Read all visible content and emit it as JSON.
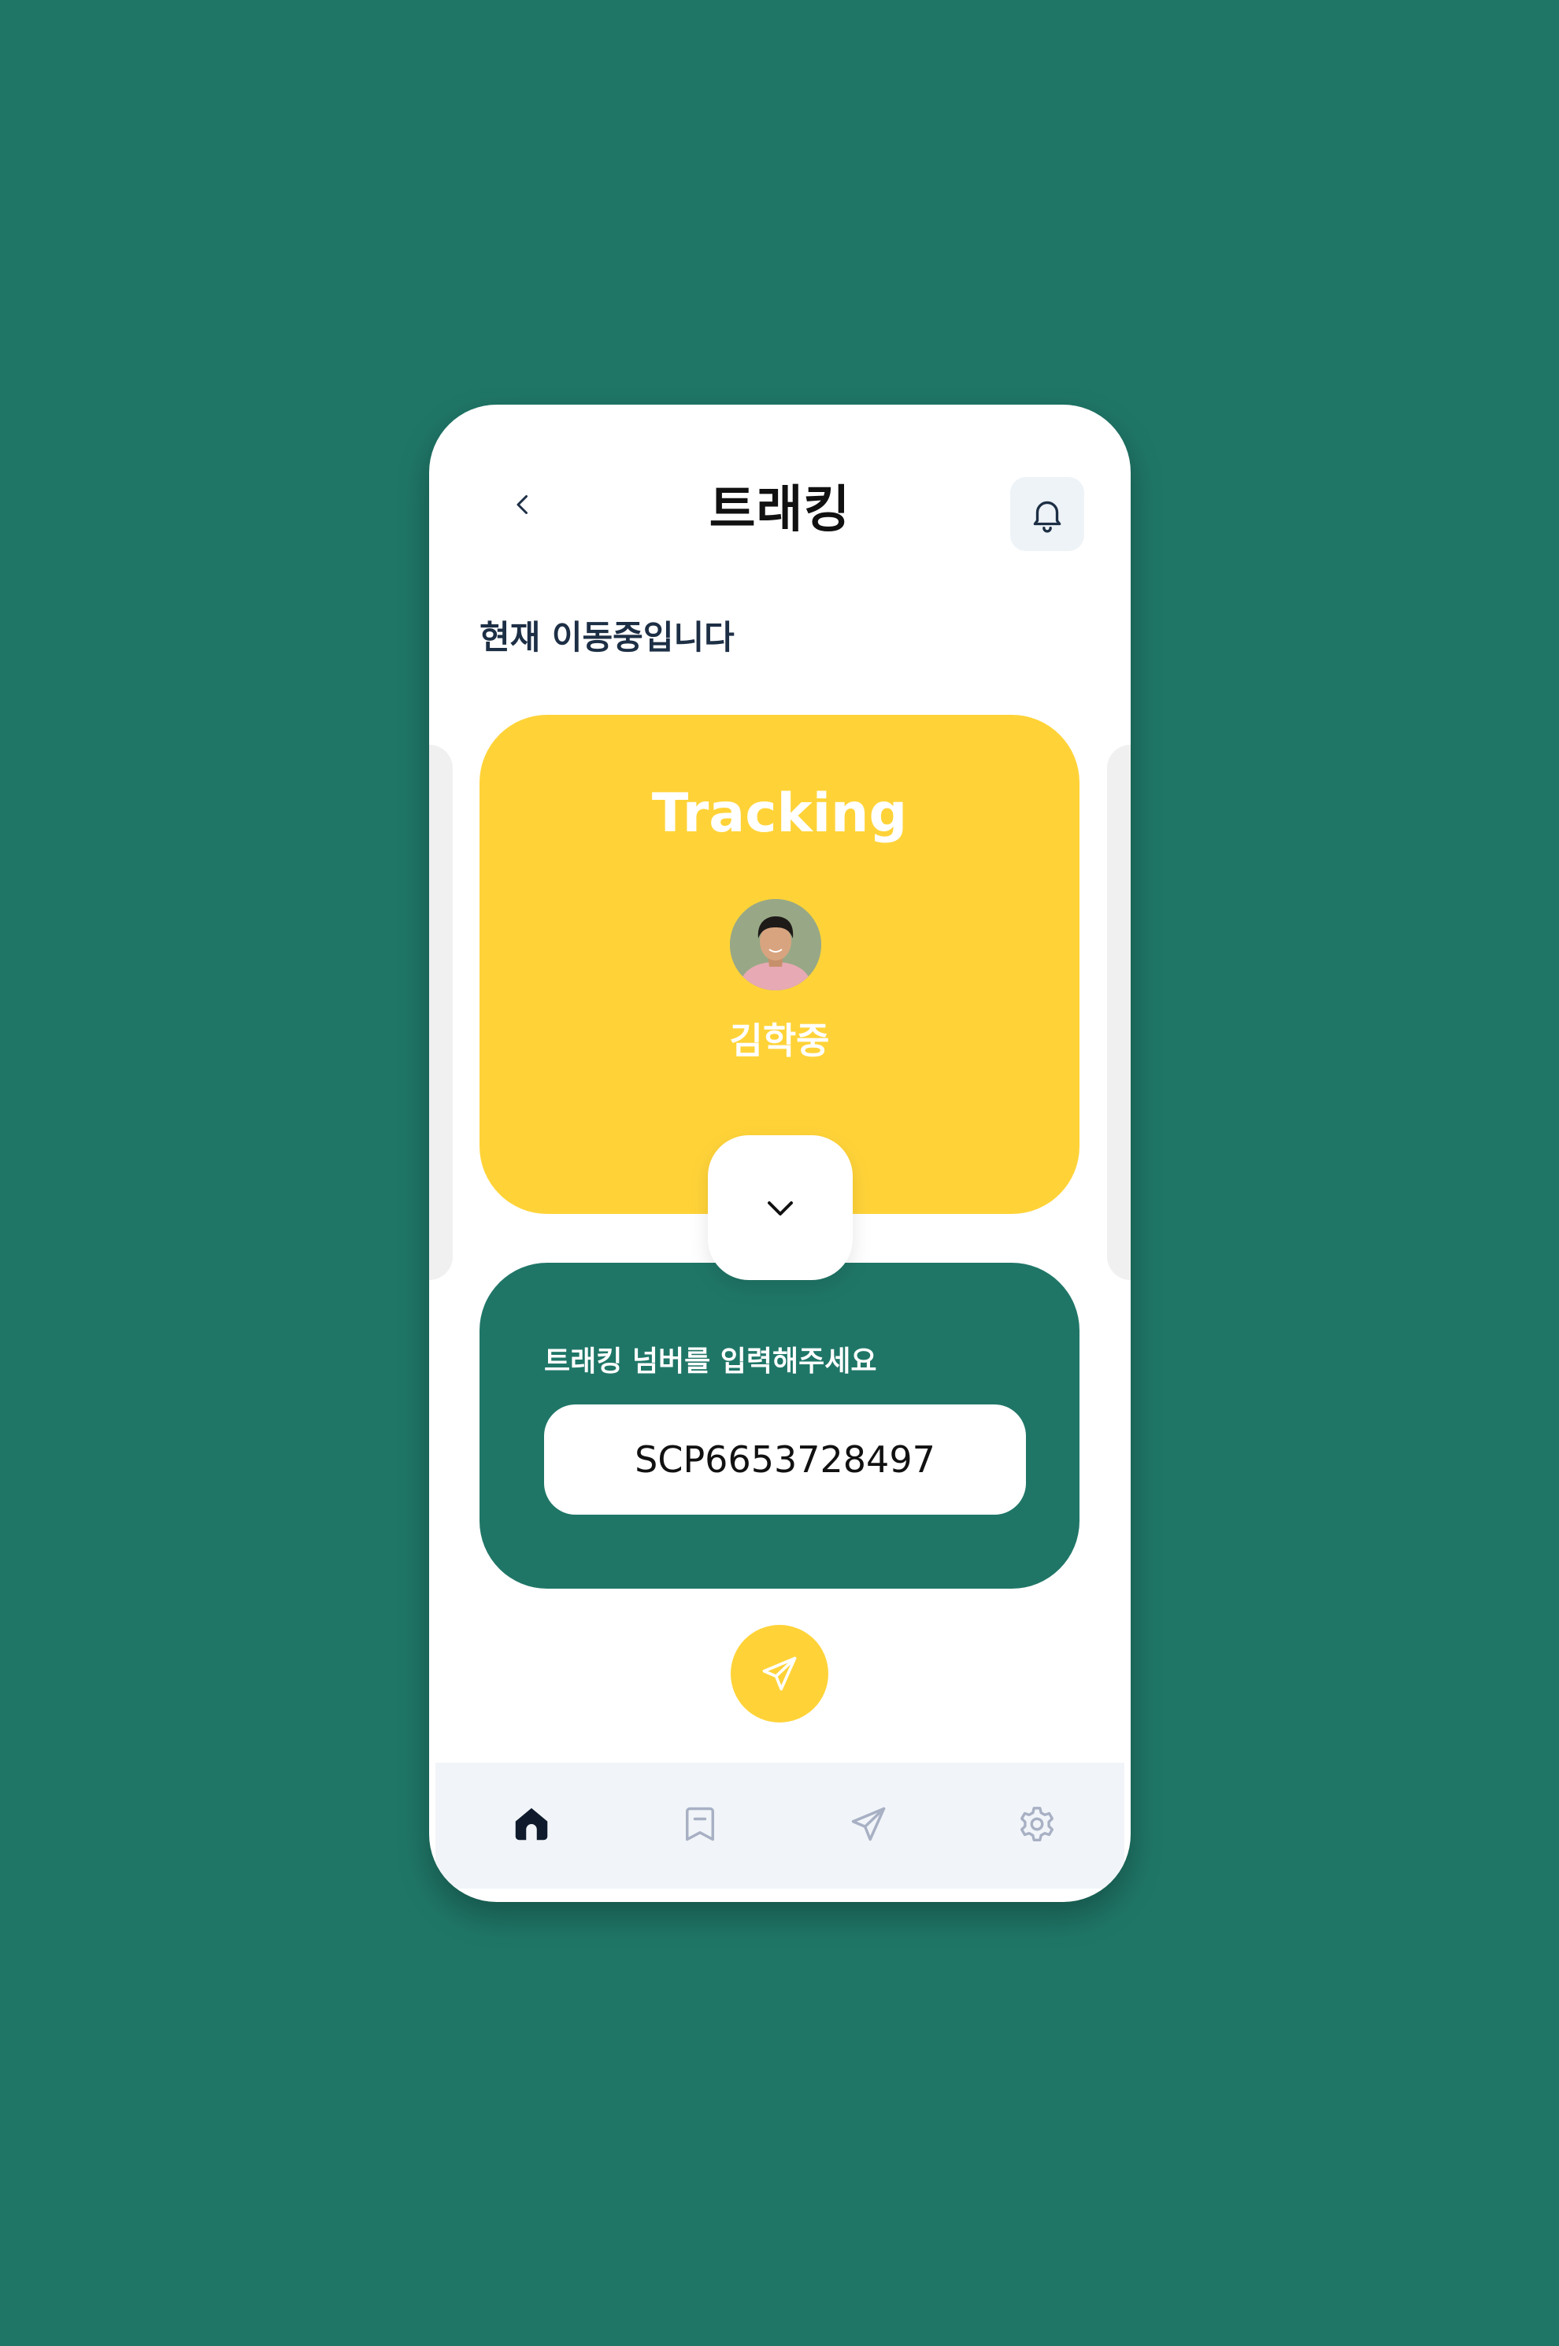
{
  "header": {
    "title": "트래킹",
    "back_icon": "chevron-left-icon",
    "notification_icon": "bell-icon"
  },
  "status": {
    "text": "현재 이동중입니다"
  },
  "tracking_card": {
    "title": "Tracking",
    "name": "김학중",
    "avatar": "avatar-photo",
    "expand_icon": "chevron-down-icon"
  },
  "tracking_input": {
    "label": "트래킹 넘버를 입력해주세요",
    "value": "SCP6653728497"
  },
  "send_button": {
    "icon": "send-icon"
  },
  "bottom_nav": {
    "items": [
      {
        "icon": "home-icon",
        "active": true
      },
      {
        "icon": "bookmark-icon",
        "active": false
      },
      {
        "icon": "send-icon",
        "active": false
      },
      {
        "icon": "gear-icon",
        "active": false
      }
    ]
  },
  "colors": {
    "background": "#1f7667",
    "accent_yellow": "#ffd338",
    "card_green": "#1f7667",
    "title_dark": "#1d2f45",
    "nav_background": "#f1f5f9",
    "nav_inactive": "#a8b0c4"
  }
}
